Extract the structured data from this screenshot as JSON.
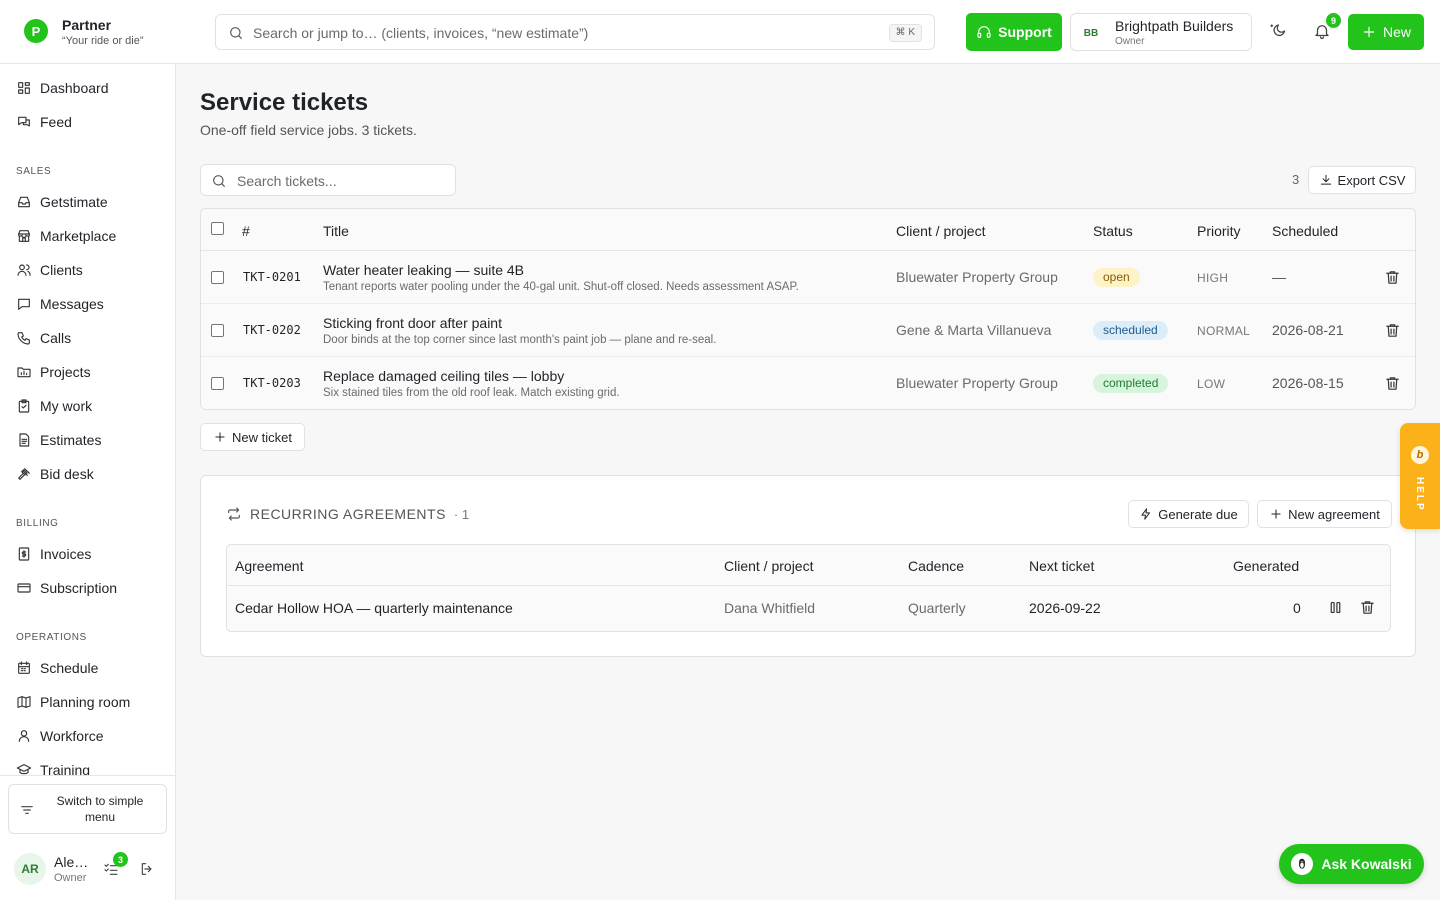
{
  "app": {
    "name": "Partner",
    "tagline": "“Your ride or die”",
    "logo_letter": "P",
    "accent_color": "#22c31a"
  },
  "header": {
    "search_placeholder": "Search or jump to… (clients, invoices, “new estimate”)",
    "search_shortcut": "⌘ K",
    "support_label": "Support",
    "org_initials": "BB",
    "org_name": "Brightpath Builders",
    "org_role": "Owner",
    "notifications_count": "9",
    "new_label": "New"
  },
  "sidebar": {
    "top_items": [
      {
        "label": "Dashboard",
        "icon": "dashboard-icon"
      },
      {
        "label": "Feed",
        "icon": "feed-icon"
      }
    ],
    "sections": [
      {
        "title": "SALES",
        "items": [
          "Getstimate",
          "Marketplace",
          "Clients",
          "Messages",
          "Calls",
          "Projects",
          "My work",
          "Estimates",
          "Bid desk"
        ]
      },
      {
        "title": "BILLING",
        "items": [
          "Invoices",
          "Subscription"
        ]
      },
      {
        "title": "OPERATIONS",
        "items": [
          "Schedule",
          "Planning room",
          "Workforce",
          "Training"
        ]
      }
    ],
    "simple_menu_label": "Switch to simple menu",
    "user_initials": "AR",
    "user_name": "Ale…",
    "user_role": "Owner",
    "tasks_count": "3"
  },
  "page": {
    "title": "Service tickets",
    "subtitle": "One-off field service jobs. 3 tickets.",
    "search_placeholder": "Search tickets...",
    "count": "3",
    "export_label": "Export CSV",
    "new_ticket_label": "New ticket"
  },
  "tickets": {
    "columns": [
      "#",
      "Title",
      "Client / project",
      "Status",
      "Priority",
      "Scheduled"
    ],
    "rows": [
      {
        "id": "TKT-0201",
        "title": "Water heater leaking — suite 4B",
        "desc": "Tenant reports water pooling under the 40-gal unit. Shut-off closed. Needs assessment ASAP.",
        "client": "Bluewater Property Group",
        "status": "open",
        "priority": "HIGH",
        "scheduled": "—"
      },
      {
        "id": "TKT-0202",
        "title": "Sticking front door after paint",
        "desc": "Door binds at the top corner since last month's paint job — plane and re-seal.",
        "client": "Gene & Marta Villanueva",
        "status": "scheduled",
        "priority": "NORMAL",
        "scheduled": "2026-08-21"
      },
      {
        "id": "TKT-0203",
        "title": "Replace damaged ceiling tiles — lobby",
        "desc": "Six stained tiles from the old roof leak. Match existing grid.",
        "client": "Bluewater Property Group",
        "status": "completed",
        "priority": "LOW",
        "scheduled": "2026-08-15"
      }
    ]
  },
  "status_colors": {
    "open": {
      "bg": "#fdf3c7",
      "fg": "#8a5a00"
    },
    "scheduled": {
      "bg": "#dcedfa",
      "fg": "#1e5a8c"
    },
    "completed": {
      "bg": "#d7f5dc",
      "fg": "#1e7a2e"
    }
  },
  "recurring": {
    "title": "RECURRING AGREEMENTS",
    "count": "· 1",
    "generate_label": "Generate due",
    "new_agreement_label": "New agreement",
    "columns": [
      "Agreement",
      "Client / project",
      "Cadence",
      "Next ticket",
      "Generated"
    ],
    "rows": [
      {
        "agreement": "Cedar Hollow HOA — quarterly maintenance",
        "client": "Dana Whitfield",
        "cadence": "Quarterly",
        "next_ticket": "2026-09-22",
        "generated": "0"
      }
    ]
  },
  "help": {
    "label": "HELP",
    "icon_letter": "b"
  },
  "assistant": {
    "label": "Ask Kowalski"
  }
}
